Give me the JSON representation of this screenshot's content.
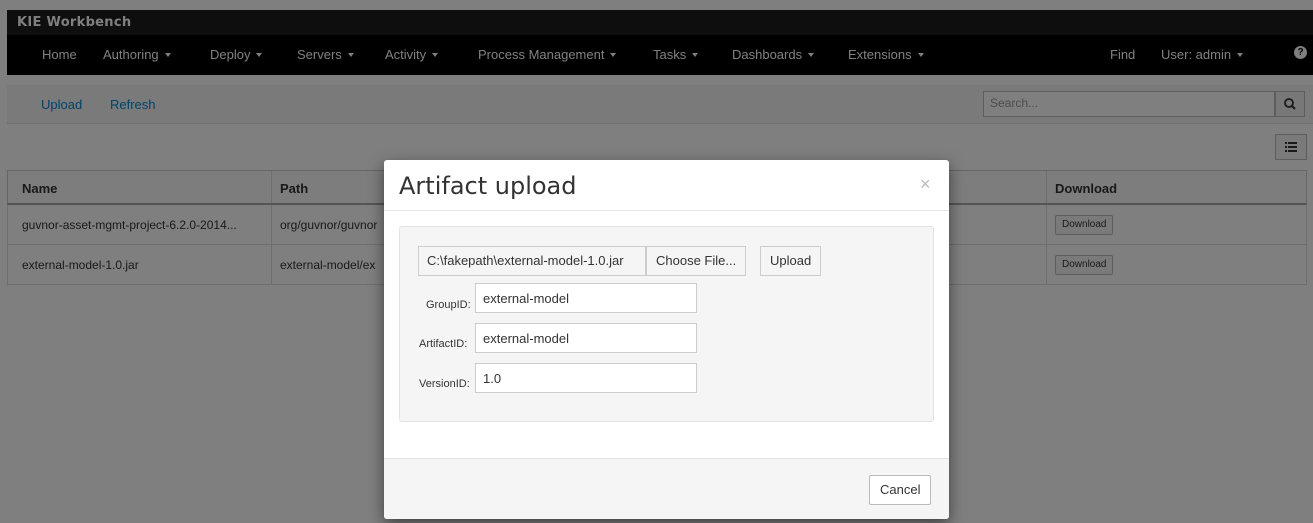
{
  "app": {
    "title": "KIE Workbench"
  },
  "nav": {
    "items": [
      {
        "label": "Home",
        "dropdown": false
      },
      {
        "label": "Authoring",
        "dropdown": true
      },
      {
        "label": "Deploy",
        "dropdown": true
      },
      {
        "label": "Servers",
        "dropdown": true
      },
      {
        "label": "Activity",
        "dropdown": true
      },
      {
        "label": "Process Management",
        "dropdown": true
      },
      {
        "label": "Tasks",
        "dropdown": true
      },
      {
        "label": "Dashboards",
        "dropdown": true
      },
      {
        "label": "Extensions",
        "dropdown": true
      }
    ],
    "find": "Find",
    "user": "User: admin",
    "help_icon": "question-circle-icon"
  },
  "toolbar": {
    "upload": "Upload",
    "refresh": "Refresh",
    "search_placeholder": "Search..."
  },
  "table": {
    "columns": [
      "Name",
      "Path",
      "Download"
    ],
    "rows": [
      {
        "name": "guvnor-asset-mgmt-project-6.2.0-2014...",
        "path": "org/guvnor/guvnor",
        "download": "Download"
      },
      {
        "name": "external-model-1.0.jar",
        "path": "external-model/ex",
        "download": "Download"
      }
    ]
  },
  "modal": {
    "title": "Artifact upload",
    "close": "×",
    "file_path": "C:\\fakepath\\external-model-1.0.jar",
    "choose_file": "Choose File...",
    "upload": "Upload",
    "group_label": "GroupID:",
    "group_value": "external-model",
    "artifact_label": "ArtifactID:",
    "artifact_value": "external-model",
    "version_label": "VersionID:",
    "version_value": "1.0",
    "cancel": "Cancel"
  }
}
